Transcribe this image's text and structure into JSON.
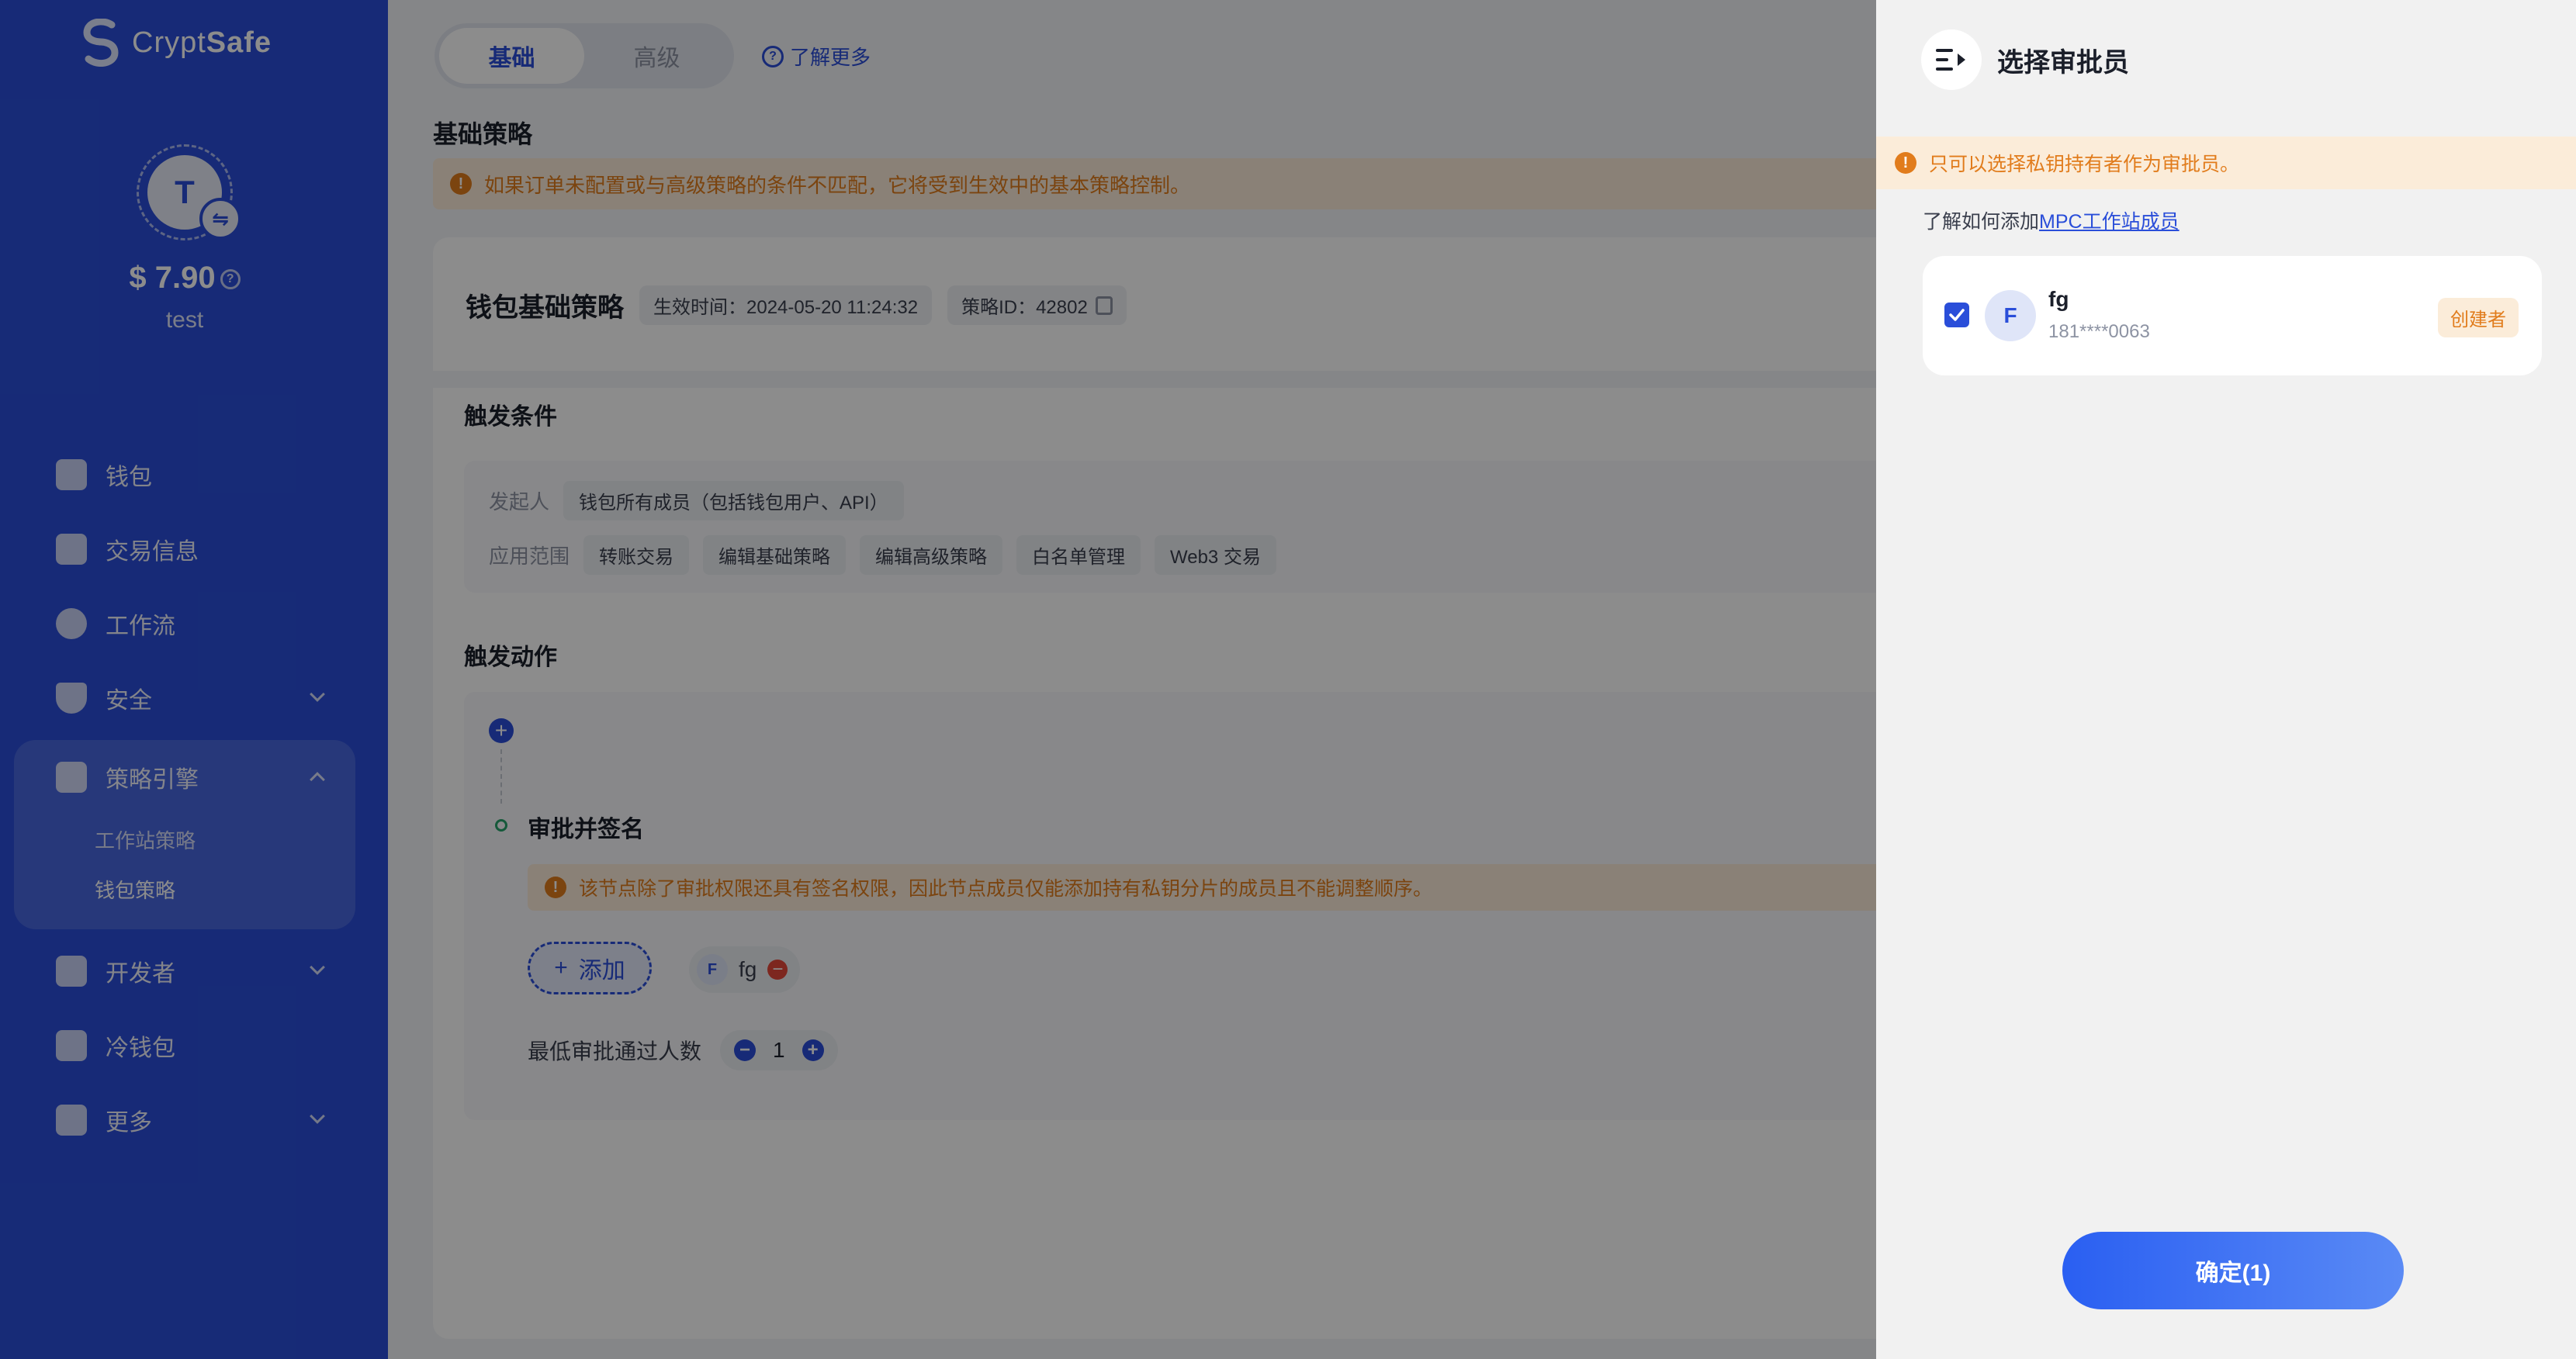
{
  "app": {
    "logo_prefix": "Crypt",
    "logo_suffix": "Safe",
    "avatar_letter": "T",
    "balance": "$ 7.90",
    "account_name": "test"
  },
  "sidebar": {
    "items": [
      {
        "label": "钱包",
        "icon": "wallet-icon"
      },
      {
        "label": "交易信息",
        "icon": "transactions-icon"
      },
      {
        "label": "工作流",
        "icon": "workflow-icon"
      },
      {
        "label": "安全",
        "icon": "shield-icon"
      },
      {
        "label": "策略引擎",
        "icon": "strategy-icon"
      },
      {
        "label": "开发者",
        "icon": "developer-icon"
      },
      {
        "label": "冷钱包",
        "icon": "cold-wallet-icon"
      },
      {
        "label": "更多",
        "icon": "more-icon"
      }
    ],
    "sub_items": [
      "工作站策略",
      "钱包策略"
    ]
  },
  "main": {
    "tabs": [
      "基础",
      "高级"
    ],
    "learn_more": "了解更多",
    "section_title": "基础策略",
    "warning": "如果订单未配置或与高级策略的条件不匹配，它将受到生效中的基本策略控制。",
    "card": {
      "title": "钱包基础策略",
      "effective_time": "生效时间：2024-05-20 11:24:32",
      "policy_id": "策略ID：42802"
    },
    "trigger": {
      "title": "触发条件",
      "initiator_label": "发起人",
      "initiator_value": "钱包所有成员（包括钱包用户、API）",
      "scope_label": "应用范围",
      "scope_chips": [
        "转账交易",
        "编辑基础策略",
        "编辑高级策略",
        "白名单管理",
        "Web3 交易"
      ]
    },
    "action": {
      "title": "触发动作",
      "node_title": "审批并签名",
      "node_warning": "该节点除了审批权限还具有签名权限，因此节点成员仅能添加持有私钥分片的成员且不能调整顺序。",
      "add_label": "添加",
      "member_letter": "F",
      "member_name": "fg",
      "min_label": "最低审批通过人数",
      "min_value": "1"
    }
  },
  "drawer": {
    "title": "选择审批员",
    "warning": "只可以选择私钥持有者作为审批员。",
    "learn_prefix": "了解如何添加",
    "learn_link": "MPC工作站成员",
    "member": {
      "letter": "F",
      "name": "fg",
      "phone": "181****0063",
      "badge": "创建者",
      "checked": true
    },
    "confirm_label": "确定(1)"
  },
  "colors": {
    "brand": "#2a4ed9",
    "warning": "#e17c1c",
    "warning_bg": "#fbecd9"
  }
}
